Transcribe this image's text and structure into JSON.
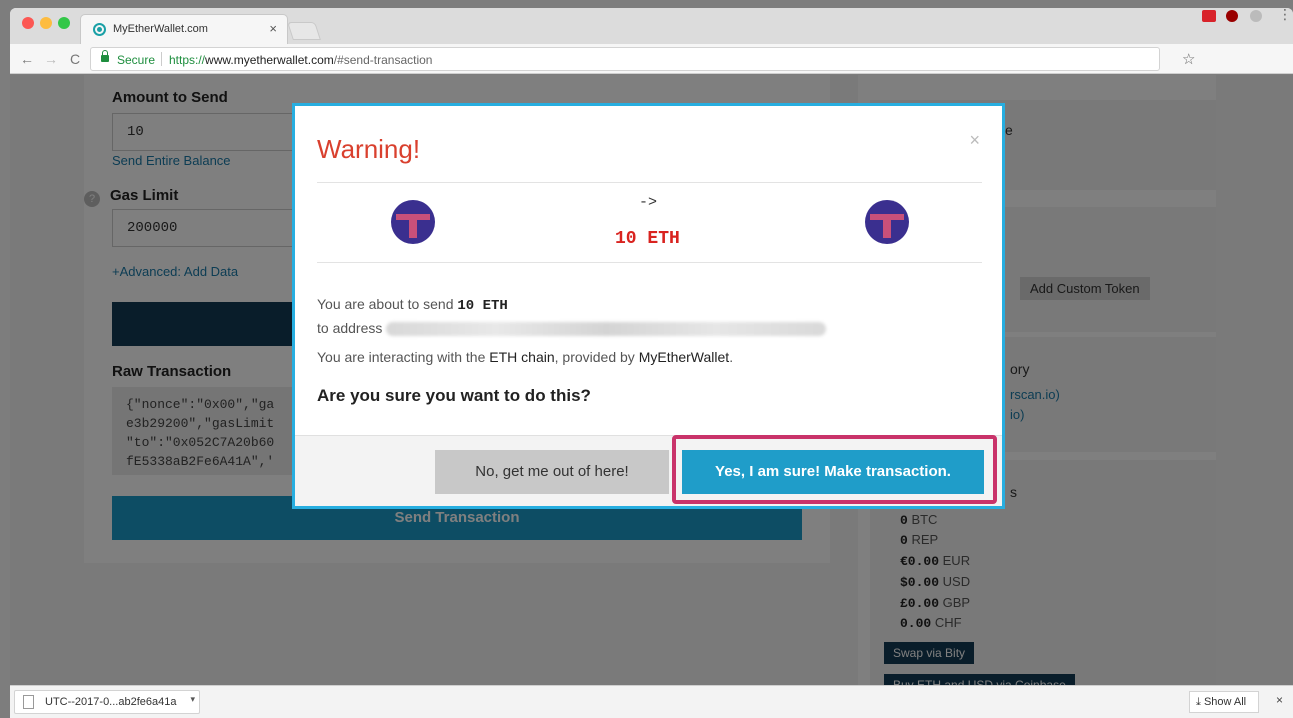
{
  "browser": {
    "tab_title": "MyEtherWallet.com",
    "tab_close": "×",
    "secure_label": "Secure",
    "url_scheme": "https://",
    "url_domain": "www.myetherwallet.com",
    "url_path": "/#send-transaction",
    "nav_back": "←",
    "nav_forward": "→",
    "nav_reload": "C",
    "bookmark": "☆",
    "menu": "⋮"
  },
  "form": {
    "amount_label": "Amount to Send",
    "amount_value": "10",
    "send_entire_balance": "Send Entire Balance",
    "gas_limit_label": "Gas Limit",
    "gas_limit_value": "200000",
    "advanced_link": "+Advanced: Add Data",
    "raw_transaction_label": "Raw Transaction",
    "raw_transaction_text": "{\"nonce\":\"0x00\",\"ga\ne3b29200\",\"gasLimit\n\"to\":\"0x052C7A20b60\nfE5338aB2Fe6A41A\",'",
    "send_button": "Send Transaction"
  },
  "sidebar": {
    "add_custom_token": "Add Custom Token",
    "history_fragment": "ory",
    "link_fragment_1": "rscan.io)",
    "link_fragment_2": "io)",
    "values_fragment": "s",
    "e_fragment": "e",
    "balances": [
      {
        "amount": "0",
        "unit": "BTC"
      },
      {
        "amount": "0",
        "unit": "REP"
      },
      {
        "amount": "€0.00",
        "unit": "EUR"
      },
      {
        "amount": "$0.00",
        "unit": "USD"
      },
      {
        "amount": "£0.00",
        "unit": "GBP"
      },
      {
        "amount": "0.00",
        "unit": "CHF"
      }
    ],
    "swap_button": "Swap via Bity",
    "buy_button": "Buy ETH and USD via Coinbase"
  },
  "modal": {
    "title": "Warning!",
    "close": "×",
    "arrow": "->",
    "amount": "10 ETH",
    "line1_prefix": "You are about to send",
    "line1_amount": "10 ETH",
    "line2_prefix": "to address",
    "line3_prefix": "You are interacting with the",
    "line3_chain": "ETH chain",
    "line3_mid": ", provided by",
    "line3_provider": "MyEtherWallet",
    "line3_suffix": ".",
    "question": "Are you sure you want to do this?",
    "cancel_button": "No, get me out of here!",
    "confirm_button": "Yes, I am sure! Make transaction.",
    "accent_color": "#27aee0",
    "title_color": "#d9402e",
    "highlight_color": "#c9336a"
  },
  "downloads": {
    "file_name": "UTC--2017-0...ab2fe6a41a",
    "caret": "▾",
    "show_all": "Show All",
    "close": "×"
  }
}
